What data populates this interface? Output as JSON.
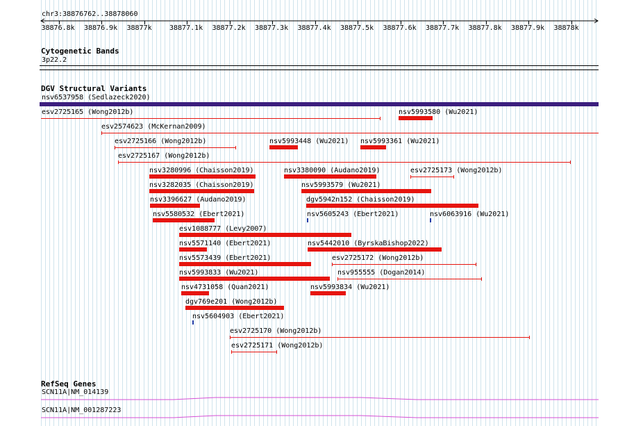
{
  "ruler": {
    "location": "chr3:38876762..38878060",
    "ticks": [
      "38876.8k",
      "38876.9k",
      "38877k",
      "38877.1k",
      "38877.2k",
      "38877.3k",
      "38877.4k",
      "38877.5k",
      "38877.6k",
      "38877.7k",
      "38877.8k",
      "38877.9k",
      "38878k"
    ]
  },
  "cytoband": {
    "title": "Cytogenetic Bands",
    "band": "3p22.2"
  },
  "dgv": {
    "title": "DGV Structural Variants",
    "summary_label": "nsv6537958 (Sedlazeck2020)",
    "summary_color": "#3b1e7e",
    "gain_color": "#e6150f",
    "point_color": "#1f3ba6",
    "features": [
      "esv2725165 (Wong2012b)",
      "nsv5993580 (Wu2021)",
      "esv2574623 (McKernan2009)",
      "esv2725166 (Wong2012b)",
      "nsv5993448 (Wu2021)",
      "nsv5993361 (Wu2021)",
      "esv2725167 (Wong2012b)",
      "nsv3280996 (Chaisson2019)",
      "nsv3380090 (Audano2019)",
      "esv2725173 (Wong2012b)",
      "nsv3282035 (Chaisson2019)",
      "nsv5993579 (Wu2021)",
      "nsv3396627 (Audano2019)",
      "dgv5942n152 (Chaisson2019)",
      "nsv5580532 (Ebert2021)",
      "nsv5605243 (Ebert2021)",
      "nsv6063916 (Wu2021)",
      "esv1088777 (Levy2007)",
      "nsv5571140 (Ebert2021)",
      "nsv5442010 (ByrskaBishop2022)",
      "nsv5573439 (Ebert2021)",
      "esv2725172 (Wong2012b)",
      "nsv5993833 (Wu2021)",
      "nsv955555 (Dogan2014)",
      "nsv4731058 (Quan2021)",
      "nsv5993834 (Wu2021)",
      "dgv769e201 (Wong2012b)",
      "nsv5604903 (Ebert2021)",
      "esv2725170 (Wong2012b)",
      "esv2725171 (Wong2012b)"
    ]
  },
  "refseq": {
    "title": "RefSeq Genes",
    "transcripts": [
      "SCN11A|NM_014139",
      "SCN11A|NM_001287223"
    ],
    "color": "#d54fd5"
  }
}
